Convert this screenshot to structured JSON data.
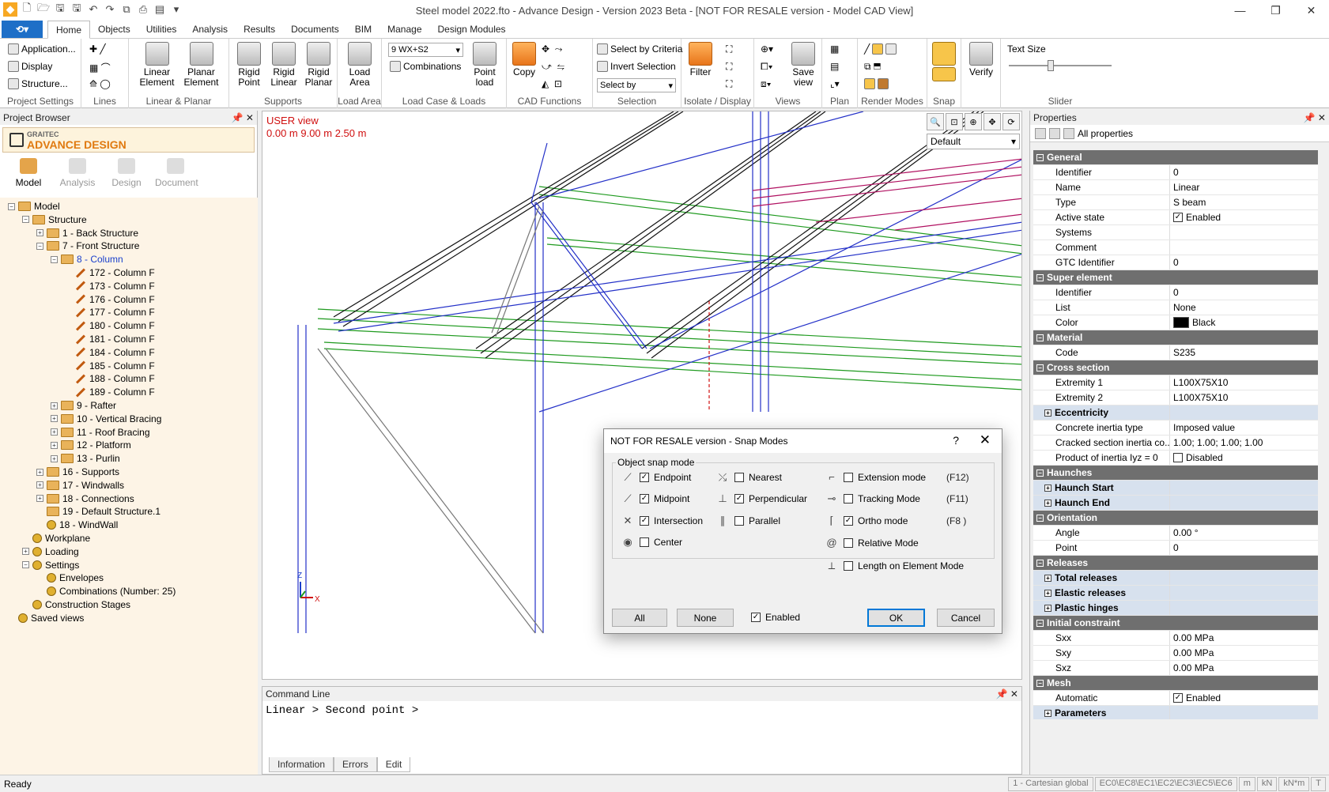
{
  "window": {
    "title": "Steel model 2022.fto - Advance Design - Version 2023 Beta - [NOT FOR RESALE version - Model CAD View]",
    "minimize": "—",
    "restore": "❐",
    "close": "✕"
  },
  "ribbon_tabs": [
    "Home",
    "Objects",
    "Utilities",
    "Analysis",
    "Results",
    "Documents",
    "BIM",
    "Manage",
    "Design Modules"
  ],
  "ribbon": {
    "project_settings": {
      "label": "Project Settings",
      "items": [
        "Application...",
        "Display",
        "Structure..."
      ]
    },
    "lines": {
      "label": "Lines"
    },
    "linear_planar": {
      "label": "Linear & Planar",
      "items": [
        "Linear Element",
        "Planar Element"
      ]
    },
    "supports": {
      "label": "Supports",
      "items": [
        "Rigid Point",
        "Rigid Linear",
        "Rigid Planar"
      ]
    },
    "load_area": {
      "label": "Load Area",
      "items": [
        "Load Area"
      ]
    },
    "load_case": {
      "label": "Load Case & Loads",
      "combo": "9 WX+S2",
      "combinations": "Combinations",
      "point_load": "Point load"
    },
    "cad_functions": {
      "label": "CAD Functions",
      "copy": "Copy"
    },
    "selection": {
      "label": "Selection",
      "select_by_criteria": "Select by Criteria",
      "invert_selection": "Invert Selection",
      "select_by": "Select by"
    },
    "isolate": {
      "label": "Isolate / Display",
      "filter": "Filter"
    },
    "views": {
      "label": "Views",
      "save_view": "Save view"
    },
    "plan": {
      "label": "Plan"
    },
    "render": {
      "label": "Render Modes"
    },
    "snap": {
      "label": "Snap"
    },
    "verify": {
      "label": "Verify"
    },
    "slider": {
      "label": "Slider",
      "text_size": "Text Size",
      "value": 0.4
    }
  },
  "project_browser": {
    "title": "Project Browser",
    "brand_small": "GRAITEC",
    "brand_big": "ADVANCE DESIGN",
    "tabs": [
      "Model",
      "Analysis",
      "Design",
      "Document"
    ],
    "tree": [
      {
        "label": "Model",
        "level": 0,
        "expander": "-",
        "icon": "folder"
      },
      {
        "label": "Structure",
        "level": 1,
        "expander": "-",
        "icon": "folder"
      },
      {
        "label": "1 - Back Structure",
        "level": 2,
        "expander": "+",
        "icon": "folder"
      },
      {
        "label": "7 - Front Structure",
        "level": 2,
        "expander": "-",
        "icon": "folder"
      },
      {
        "label": "8 - Column",
        "level": 3,
        "expander": "-",
        "icon": "folder",
        "selected": true
      },
      {
        "label": "172 - Column F",
        "level": 4,
        "icon": "beam"
      },
      {
        "label": "173 - Column F",
        "level": 4,
        "icon": "beam"
      },
      {
        "label": "176 - Column F",
        "level": 4,
        "icon": "beam"
      },
      {
        "label": "177 - Column F",
        "level": 4,
        "icon": "beam"
      },
      {
        "label": "180 - Column F",
        "level": 4,
        "icon": "beam"
      },
      {
        "label": "181 - Column F",
        "level": 4,
        "icon": "beam"
      },
      {
        "label": "184 - Column F",
        "level": 4,
        "icon": "beam"
      },
      {
        "label": "185 - Column F",
        "level": 4,
        "icon": "beam"
      },
      {
        "label": "188 - Column F",
        "level": 4,
        "icon": "beam"
      },
      {
        "label": "189 - Column F",
        "level": 4,
        "icon": "beam"
      },
      {
        "label": "9 - Rafter",
        "level": 3,
        "expander": "+",
        "icon": "folder"
      },
      {
        "label": "10 - Vertical Bracing",
        "level": 3,
        "expander": "+",
        "icon": "folder"
      },
      {
        "label": "11 - Roof Bracing",
        "level": 3,
        "expander": "+",
        "icon": "folder"
      },
      {
        "label": "12 - Platform",
        "level": 3,
        "expander": "+",
        "icon": "folder"
      },
      {
        "label": "13 - Purlin",
        "level": 3,
        "expander": "+",
        "icon": "folder"
      },
      {
        "label": "16 - Supports",
        "level": 2,
        "expander": "+",
        "icon": "folder"
      },
      {
        "label": "17 - Windwalls",
        "level": 2,
        "expander": "+",
        "icon": "folder"
      },
      {
        "label": "18 - Connections",
        "level": 2,
        "expander": "+",
        "icon": "folder"
      },
      {
        "label": "19 - Default Structure.1",
        "level": 2,
        "icon": "folder"
      },
      {
        "label": "18 - WindWall",
        "level": 2,
        "icon": "diamond"
      },
      {
        "label": "Workplane",
        "level": 1,
        "icon": "grid"
      },
      {
        "label": "Loading",
        "level": 1,
        "expander": "+",
        "icon": "gear"
      },
      {
        "label": "Settings",
        "level": 1,
        "expander": "-",
        "icon": "gear"
      },
      {
        "label": "Envelopes",
        "level": 2,
        "icon": "gear"
      },
      {
        "label": "Combinations (Number: 25)",
        "level": 2,
        "icon": "gear"
      },
      {
        "label": "Construction Stages",
        "level": 1,
        "icon": "gear"
      },
      {
        "label": "Saved views",
        "level": 0,
        "icon": "gear"
      }
    ]
  },
  "viewport": {
    "view_name": "USER view",
    "coords": "0.00 m  9.00 m  2.50 m",
    "display_combo": "Default",
    "axis_x": "X",
    "axis_z": "Z"
  },
  "command_line": {
    "title": "Command Line",
    "text": "Linear > Second point >",
    "tabs": [
      "Information",
      "Errors",
      "Edit"
    ]
  },
  "properties": {
    "title": "Properties",
    "filter": "All properties",
    "rows": [
      {
        "kind": "cat",
        "name": "General"
      },
      {
        "name": "Identifier",
        "value": "0"
      },
      {
        "name": "Name",
        "value": "Linear"
      },
      {
        "name": "Type",
        "value": "S beam"
      },
      {
        "name": "Active state",
        "value": "Enabled",
        "checkbox": true
      },
      {
        "name": "Systems",
        "value": ""
      },
      {
        "name": "Comment",
        "value": ""
      },
      {
        "name": "GTC Identifier",
        "value": "0"
      },
      {
        "kind": "cat",
        "name": "Super element"
      },
      {
        "name": "Identifier",
        "value": "0"
      },
      {
        "name": "List",
        "value": "None"
      },
      {
        "name": "Color",
        "value": "Black",
        "swatch": "#000000"
      },
      {
        "kind": "cat",
        "name": "Material"
      },
      {
        "name": "Code",
        "value": "S235"
      },
      {
        "kind": "cat",
        "name": "Cross section"
      },
      {
        "name": "Extremity 1",
        "value": "L100X75X10"
      },
      {
        "name": "Extremity 2",
        "value": "L100X75X10"
      },
      {
        "kind": "sub",
        "name": "Eccentricity"
      },
      {
        "name": "Concrete inertia type",
        "value": "Imposed value"
      },
      {
        "name": "Cracked section inertia co...",
        "value": "1.00; 1.00; 1.00; 1.00"
      },
      {
        "name": "Product of inertia Iyz = 0",
        "value": "Disabled",
        "checkbox": false
      },
      {
        "kind": "cat",
        "name": "Haunches"
      },
      {
        "kind": "sub",
        "name": "Haunch Start"
      },
      {
        "kind": "sub",
        "name": "Haunch End"
      },
      {
        "kind": "cat",
        "name": "Orientation"
      },
      {
        "name": "Angle",
        "value": "0.00 °"
      },
      {
        "name": "Point",
        "value": "0"
      },
      {
        "kind": "cat",
        "name": "Releases"
      },
      {
        "kind": "sub",
        "name": "Total releases"
      },
      {
        "kind": "sub",
        "name": "Elastic releases"
      },
      {
        "kind": "sub",
        "name": "Plastic hinges"
      },
      {
        "kind": "cat",
        "name": "Initial constraint"
      },
      {
        "name": "Sxx",
        "value": "0.00 MPa"
      },
      {
        "name": "Sxy",
        "value": "0.00 MPa"
      },
      {
        "name": "Sxz",
        "value": "0.00 MPa"
      },
      {
        "kind": "cat",
        "name": "Mesh"
      },
      {
        "name": "Automatic",
        "value": "Enabled",
        "checkbox": true
      },
      {
        "kind": "sub",
        "name": "Parameters"
      }
    ]
  },
  "dialog": {
    "title": "NOT FOR RESALE version - Snap Modes",
    "help": "?",
    "close": "✕",
    "group_label": "Object snap mode",
    "left_options": [
      {
        "label": "Endpoint",
        "checked": true,
        "icon": "endpoint-icon",
        "glyph": "⟋"
      },
      {
        "label": "Midpoint",
        "checked": true,
        "icon": "midpoint-icon",
        "glyph": "⟋"
      },
      {
        "label": "Intersection",
        "checked": true,
        "icon": "intersection-icon",
        "glyph": "✕"
      },
      {
        "label": "Center",
        "checked": false,
        "icon": "center-icon",
        "glyph": "◉"
      }
    ],
    "mid_options": [
      {
        "label": "Nearest",
        "checked": false,
        "icon": "nearest-icon",
        "glyph": "⤯"
      },
      {
        "label": "Perpendicular",
        "checked": true,
        "icon": "perpendicular-icon",
        "glyph": "⊥"
      },
      {
        "label": "Parallel",
        "checked": false,
        "icon": "parallel-icon",
        "glyph": "∥"
      }
    ],
    "right_options": [
      {
        "label": "Extension mode",
        "checked": false,
        "key": "(F12)",
        "icon": "extension-icon",
        "glyph": "⌐"
      },
      {
        "label": "Tracking Mode",
        "checked": false,
        "key": "(F11)",
        "icon": "tracking-icon",
        "glyph": "⊸"
      },
      {
        "label": "Ortho mode",
        "checked": true,
        "key": "(F8 )",
        "icon": "ortho-icon",
        "glyph": "⌈"
      },
      {
        "label": "Relative Mode",
        "checked": false,
        "key": "",
        "icon": "relative-icon",
        "glyph": "@"
      },
      {
        "label": "Length on Element Mode",
        "checked": false,
        "key": "",
        "icon": "length-icon",
        "glyph": "⟂"
      }
    ],
    "all_button": "All",
    "none_button": "None",
    "enabled_label": "Enabled",
    "enabled_checked": true,
    "ok_button": "OK",
    "cancel_button": "Cancel"
  },
  "status": {
    "ready": "Ready",
    "coord_system": "1 - Cartesian global",
    "eurocodes": "EC0\\EC8\\EC1\\EC2\\EC3\\EC5\\EC6",
    "units": [
      "m",
      "kN",
      "kN*m",
      "T"
    ]
  }
}
